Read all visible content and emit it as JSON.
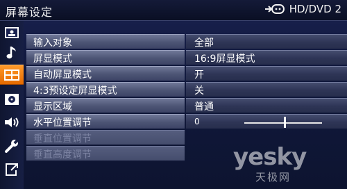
{
  "header": {
    "title": "屏幕设定",
    "source": "HD/DVD 2"
  },
  "sidebar": {
    "items": [
      {
        "icon": "picture-icon"
      },
      {
        "icon": "music-note-icon"
      },
      {
        "icon": "screen-setting-icon",
        "active": true
      },
      {
        "icon": "disc-icon"
      },
      {
        "icon": "speaker-icon"
      },
      {
        "icon": "wrench-icon"
      },
      {
        "icon": "exit-icon"
      }
    ]
  },
  "menu": {
    "rows": [
      {
        "label": "输入对象",
        "value": "全部"
      },
      {
        "label": "屏显模式",
        "value": "16:9屏显模式"
      },
      {
        "label": "自动屏显模式",
        "value": "开"
      },
      {
        "label": "4:3预设定屏显模式",
        "value": "关"
      },
      {
        "label": "显示区域",
        "value": "普通"
      },
      {
        "label": "水平位置调节",
        "value": "0",
        "slider_position": 0.52
      },
      {
        "label": "垂直位置调节",
        "disabled": true
      },
      {
        "label": "垂直高度调节",
        "disabled": true
      }
    ]
  },
  "watermark": {
    "brand": "yesky",
    "chinese": "天极网"
  },
  "colors": {
    "accent": "#ff8a1a"
  }
}
